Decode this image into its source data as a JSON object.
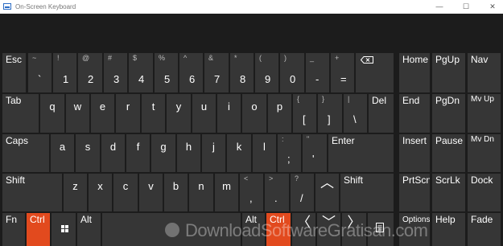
{
  "window": {
    "title": "On-Screen Keyboard",
    "minimize": "—",
    "maximize": "☐",
    "close": "✕"
  },
  "colors": {
    "accent": "#e24a1e",
    "key": "#363636",
    "background": "#1c1c1c"
  },
  "keys": {
    "esc": "Esc",
    "backtick": {
      "sub": "~",
      "main": "`"
    },
    "k1": {
      "sub": "!",
      "main": "1"
    },
    "k2": {
      "sub": "@",
      "main": "2"
    },
    "k3": {
      "sub": "#",
      "main": "3"
    },
    "k4": {
      "sub": "$",
      "main": "4"
    },
    "k5": {
      "sub": "%",
      "main": "5"
    },
    "k6": {
      "sub": "^",
      "main": "6"
    },
    "k7": {
      "sub": "&",
      "main": "7"
    },
    "k8": {
      "sub": "*",
      "main": "8"
    },
    "k9": {
      "sub": "(",
      "main": "9"
    },
    "k0": {
      "sub": ")",
      "main": "0"
    },
    "minus": {
      "sub": "_",
      "main": "-"
    },
    "equals": {
      "sub": "+",
      "main": "="
    },
    "tab": "Tab",
    "q": "q",
    "w": "w",
    "e": "e",
    "r": "r",
    "t": "t",
    "y": "y",
    "u": "u",
    "i": "i",
    "o": "o",
    "p": "p",
    "lbracket": {
      "sub": "{",
      "main": "["
    },
    "rbracket": {
      "sub": "}",
      "main": "]"
    },
    "backslash": {
      "sub": "|",
      "main": "\\"
    },
    "del": "Del",
    "caps": "Caps",
    "a": "a",
    "s": "s",
    "d": "d",
    "f": "f",
    "g": "g",
    "h": "h",
    "j": "j",
    "k": "k",
    "l": "l",
    "semicolon": {
      "sub": ":",
      "main": ";"
    },
    "quote": {
      "sub": "\"",
      "main": "'"
    },
    "enter": "Enter",
    "shift_left": "Shift",
    "z": "z",
    "x": "x",
    "c": "c",
    "v": "v",
    "b": "b",
    "n": "n",
    "m": "m",
    "comma": {
      "sub": "<",
      "main": ","
    },
    "period": {
      "sub": ">",
      "main": "."
    },
    "slash": {
      "sub": "?",
      "main": "/"
    },
    "up_arrow": "︿",
    "shift_right": "Shift",
    "fn": "Fn",
    "ctrl_left": "Ctrl",
    "alt_left": "Alt",
    "alt_right": "Alt",
    "ctrl_right": "Ctrl",
    "left_arrow": "〈",
    "down_arrow": "﹀",
    "right_arrow": "〉",
    "home": "Home",
    "pgup": "PgUp",
    "nav": "Nav",
    "end": "End",
    "pgdn": "PgDn",
    "mvup": "Mv Up",
    "insert": "Insert",
    "pause": "Pause",
    "mvdn": "Mv Dn",
    "prtscn": "PrtScn",
    "scrlk": "ScrLk",
    "dock": "Dock",
    "options": "Options",
    "help": "Help",
    "fade": "Fade"
  },
  "watermark": "DownloadSoftwareGratisan.com"
}
